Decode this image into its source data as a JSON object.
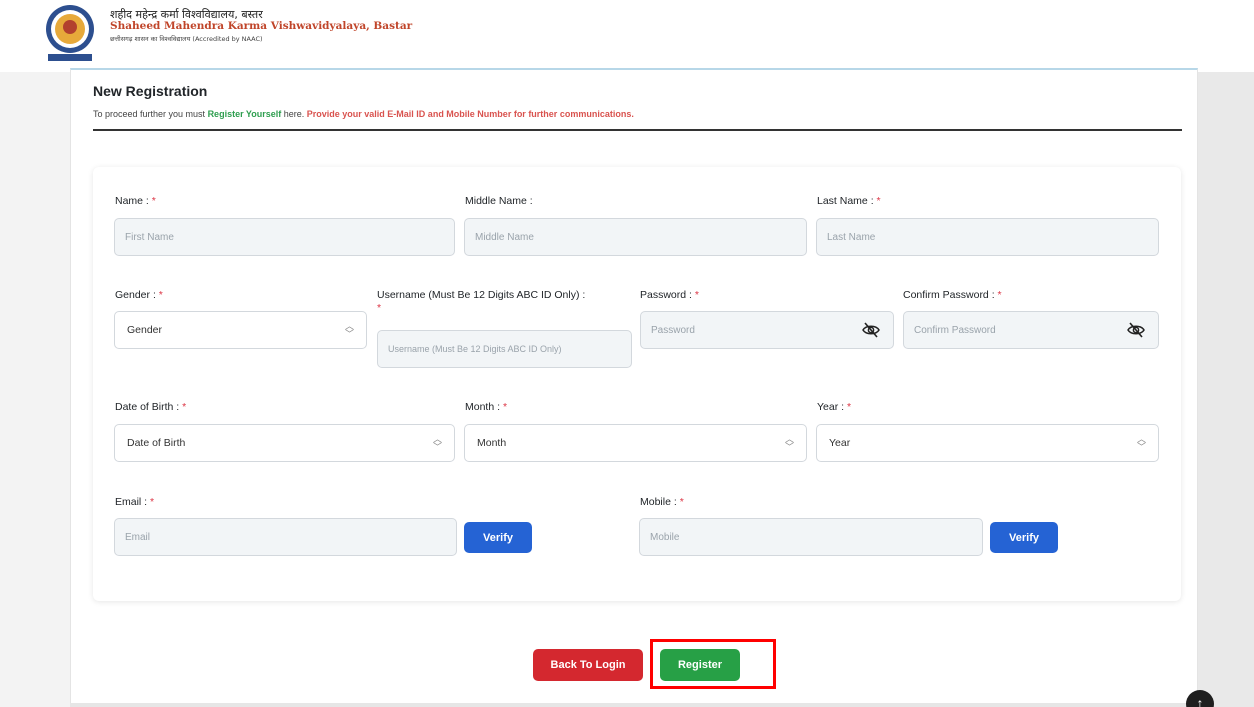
{
  "header": {
    "brand_hindi": "शहीद महेन्द्र कर्मा विश्वविद्यालय, बस्तर",
    "brand_english": "Shaheed Mahendra Karma Vishwavidyalaya, Bastar",
    "brand_sub": "छत्तीसगढ़ शासन का विश्वविद्यालय (Accredited by NAAC)"
  },
  "page": {
    "title": "New Registration",
    "intro_prefix": "To proceed further you must ",
    "intro_highlight": "Register Yourself",
    "intro_middle": " here. ",
    "intro_warning": "Provide your valid E-Mail ID and Mobile Number for further communications."
  },
  "form": {
    "required_mark": "*",
    "first_name": {
      "label": "Name :",
      "placeholder": "First Name"
    },
    "middle_name": {
      "label": "Middle Name :",
      "placeholder": "Middle Name"
    },
    "last_name": {
      "label": "Last Name :",
      "placeholder": "Last Name"
    },
    "gender": {
      "label": "Gender :",
      "value": "Gender"
    },
    "username": {
      "label": "Username (Must Be 12 Digits ABC ID Only) :",
      "placeholder": "Username (Must Be 12 Digits ABC ID Only)"
    },
    "password": {
      "label": "Password :",
      "placeholder": "Password"
    },
    "confirm_password": {
      "label": "Confirm Password :",
      "placeholder": "Confirm Password"
    },
    "dob_day": {
      "label": "Date of Birth :",
      "value": "Date of Birth"
    },
    "dob_month": {
      "label": "Month :",
      "value": "Month"
    },
    "dob_year": {
      "label": "Year :",
      "value": "Year"
    },
    "email": {
      "label": "Email :",
      "placeholder": "Email",
      "verify_label": "Verify"
    },
    "mobile": {
      "label": "Mobile :",
      "placeholder": "Mobile",
      "verify_label": "Verify"
    }
  },
  "actions": {
    "back_label": "Back To Login",
    "register_label": "Register"
  },
  "colors": {
    "primary_blue": "#2563d4",
    "danger_red": "#d4282f",
    "success_green": "#27a046",
    "highlight_outline": "#ff0000"
  },
  "icons": {
    "eye_slash": "eye-slash-icon",
    "chevron_up_down": "chevron-up-down-icon",
    "arrow_up": "arrow-up-icon"
  }
}
